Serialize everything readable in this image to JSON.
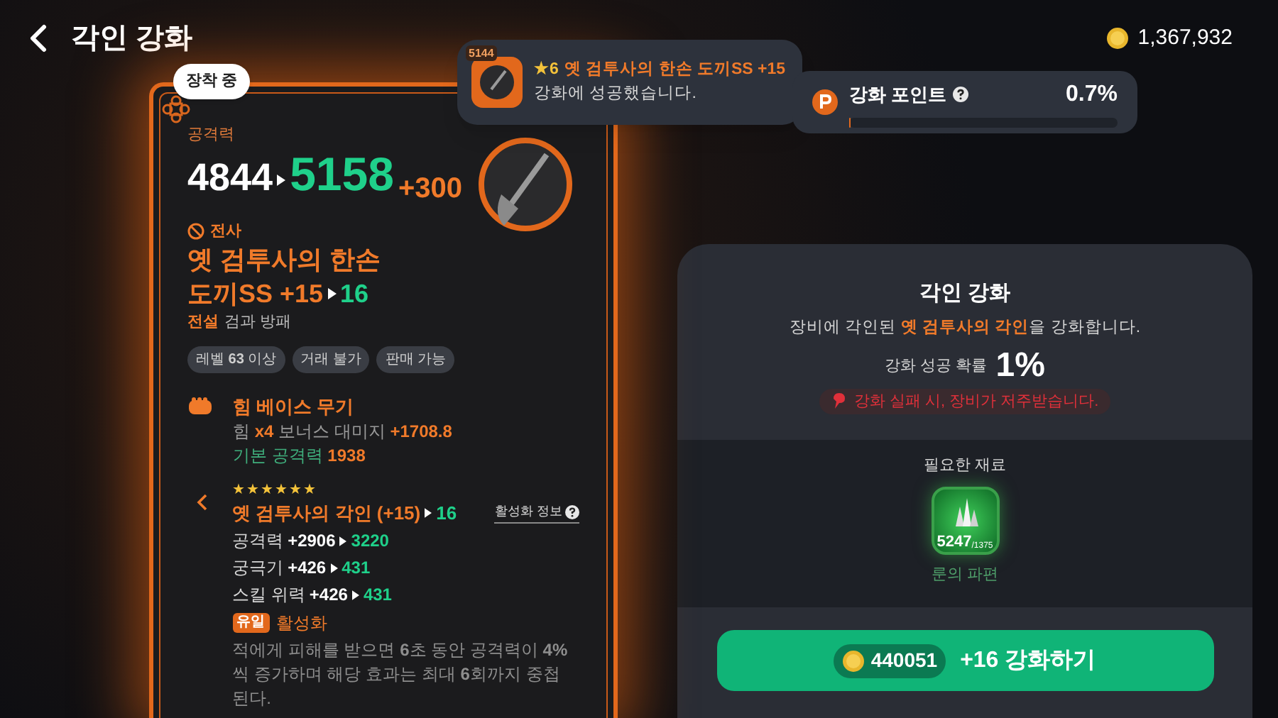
{
  "header": {
    "title": "각인 강화",
    "coins": "1,367,932"
  },
  "toast": {
    "badge": "5144",
    "grade": "★6",
    "item_name": "옛 검투사의 한손 도끼SS +15",
    "message": "강화에 성공했습니다."
  },
  "points": {
    "label": "강화 포인트",
    "value": "0.7%",
    "level": 0.007
  },
  "item_card": {
    "equipped_badge": "장착 중",
    "stat_label": "공격력",
    "stat_from": "4844",
    "stat_to": "5158",
    "stat_bonus": "+300",
    "class_name": "전사",
    "name_line": "옛 검투사의 한손",
    "name_base": "도끼SS +15",
    "name_to": "16",
    "grade": "전설",
    "type": "검과 방패",
    "tags": [
      "레벨 **63** 이상",
      "거래 불가",
      "판매 가능"
    ],
    "base_title": "힘 베이스 무기",
    "base_lines": [
      [
        {
          "text": "힘 ",
          "kind": "muted"
        },
        {
          "text": "x4",
          "kind": "accent"
        },
        {
          "text": " 보너스 대미지 ",
          "kind": "muted"
        },
        {
          "text": "+1708.8",
          "kind": "accent"
        }
      ],
      [
        {
          "text": "기본 공격력 ",
          "kind": "label"
        },
        {
          "text": "1938",
          "kind": "accent"
        }
      ]
    ],
    "engraving": {
      "stars": 6,
      "name": "옛 검투사의 각인 (+15)",
      "to": "16",
      "info_link": "활성화 정보",
      "stats": [
        {
          "label": "공격력",
          "from": "+2906",
          "to": "3220"
        },
        {
          "label": "궁극기",
          "from": "+426",
          "to": "431"
        },
        {
          "label": "스킬 위력",
          "from": "+426",
          "to": "431"
        }
      ],
      "unique_badge": "유일",
      "effect_title": "활성화",
      "effect_desc": "적에게 피해를 받으면 **6**초 동안 공격력이 **4%**씩 증가하며 해당 효과는 최대 **6**회까지 중첩된다."
    }
  },
  "enhance_panel": {
    "title": "각인 강화",
    "description": [
      {
        "text": "장비에 각인된 ",
        "kind": "plain"
      },
      {
        "text": "옛 검투사의 각인",
        "kind": "accent"
      },
      {
        "text": "을 강화합니다.",
        "kind": "plain"
      }
    ],
    "rate_label": "강화 성공 확률",
    "rate_value": "1%",
    "warning": "강화 실패 시, 장비가 저주받습니다.",
    "materials_title": "필요한 재료",
    "material": {
      "count": "5247",
      "required": "/1375",
      "name": "룬의 파편"
    },
    "button": {
      "cost": "440051",
      "label": "+16 강화하기"
    }
  }
}
